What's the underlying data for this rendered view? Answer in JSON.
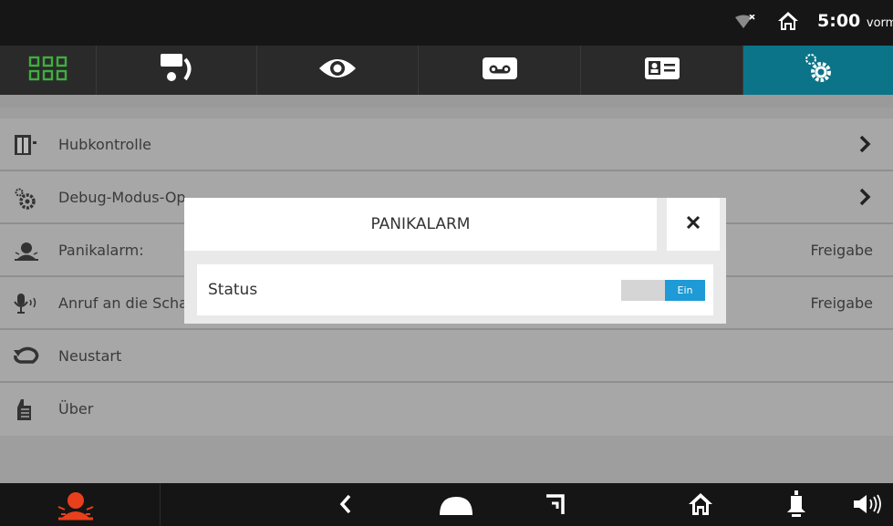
{
  "status_bar": {
    "time": "5:00",
    "time_suffix": "vorm"
  },
  "tabs": [
    {
      "icon": "grid-icon"
    },
    {
      "icon": "intercom-call-icon"
    },
    {
      "icon": "eye-icon"
    },
    {
      "icon": "voicemail-icon"
    },
    {
      "icon": "contact-card-icon"
    },
    {
      "icon": "settings-gears-icon",
      "active": true
    }
  ],
  "settings_list": [
    {
      "icon": "elevator-icon",
      "label": "Hubkontrolle",
      "chevron": true
    },
    {
      "icon": "debug-gears-icon",
      "label": "Debug-Modus-Op",
      "chevron": true
    },
    {
      "icon": "alarm-person-icon",
      "label": "Panikalarm:",
      "value": "Freigabe"
    },
    {
      "icon": "microphone-icon",
      "label": "Anruf an die Schalttafel:",
      "value": "Freigabe"
    },
    {
      "icon": "restart-icon",
      "label": "Neustart"
    },
    {
      "icon": "info-hand-icon",
      "label": "Über"
    }
  ],
  "dialog": {
    "title": "PANIKALARM",
    "status_label": "Status",
    "toggle_value": "Ein"
  },
  "colors": {
    "accent": "#0c7488",
    "toggle_on": "#1e9ad6",
    "panic": "#e8401c",
    "grid_green": "#3fae3f"
  }
}
